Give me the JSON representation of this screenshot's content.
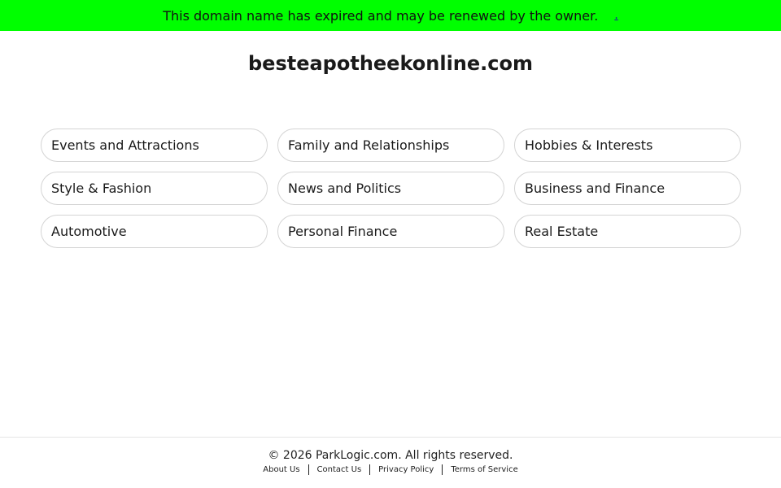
{
  "banner": {
    "message": "This domain name has expired and may be renewed by the owner.",
    "link_text": ".",
    "background_color": "#00ff00"
  },
  "domain": {
    "name": "besteapotheekonline.com"
  },
  "categories": [
    "Events and Attractions",
    "Family and Relationships",
    "Hobbies & Interests",
    "Style & Fashion",
    "News and Politics",
    "Business and Finance",
    "Automotive",
    "Personal Finance",
    "Real Estate"
  ],
  "footer": {
    "copyright": "© 2026 ParkLogic.com. All rights reserved.",
    "links": [
      "About Us",
      "Contact Us",
      "Privacy Policy",
      "Terms of Service"
    ]
  }
}
